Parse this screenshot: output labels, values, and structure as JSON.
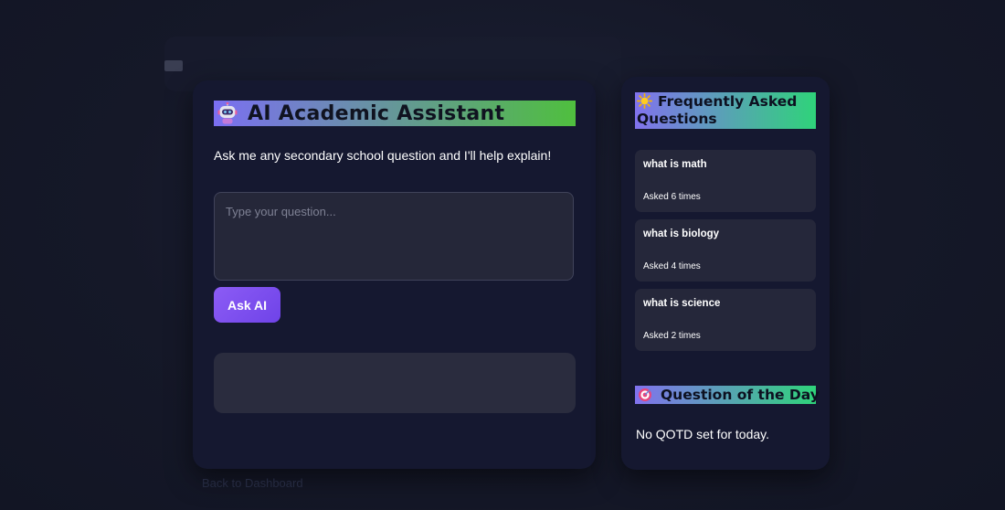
{
  "app": {
    "title": "AI Academic Assistant",
    "subtitle": "Ask me any secondary school question and I'll help explain!",
    "title_icon": "robot-icon"
  },
  "input": {
    "placeholder": "Type your question...",
    "value": ""
  },
  "ask_button": {
    "label": "Ask AI"
  },
  "answer": {
    "text": ""
  },
  "back_link": {
    "label": "Back to Dashboard"
  },
  "faq": {
    "title": "Frequently Asked Questions",
    "icon": "sun-icon",
    "items": [
      {
        "question": "what is math",
        "count_text": "Asked 6 times"
      },
      {
        "question": "what is biology",
        "count_text": "Asked 4 times"
      },
      {
        "question": "what is science",
        "count_text": "Asked 2 times"
      }
    ]
  },
  "qotd": {
    "title": "Question of the Day",
    "icon": "target-icon",
    "text": "No QOTD set for today."
  },
  "colors": {
    "accent_purple": "#7b6ff2",
    "accent_green": "#4fbf3e",
    "button_purple": "#8c5cf5",
    "card_bg": "#151830",
    "page_bg": "#151828"
  }
}
